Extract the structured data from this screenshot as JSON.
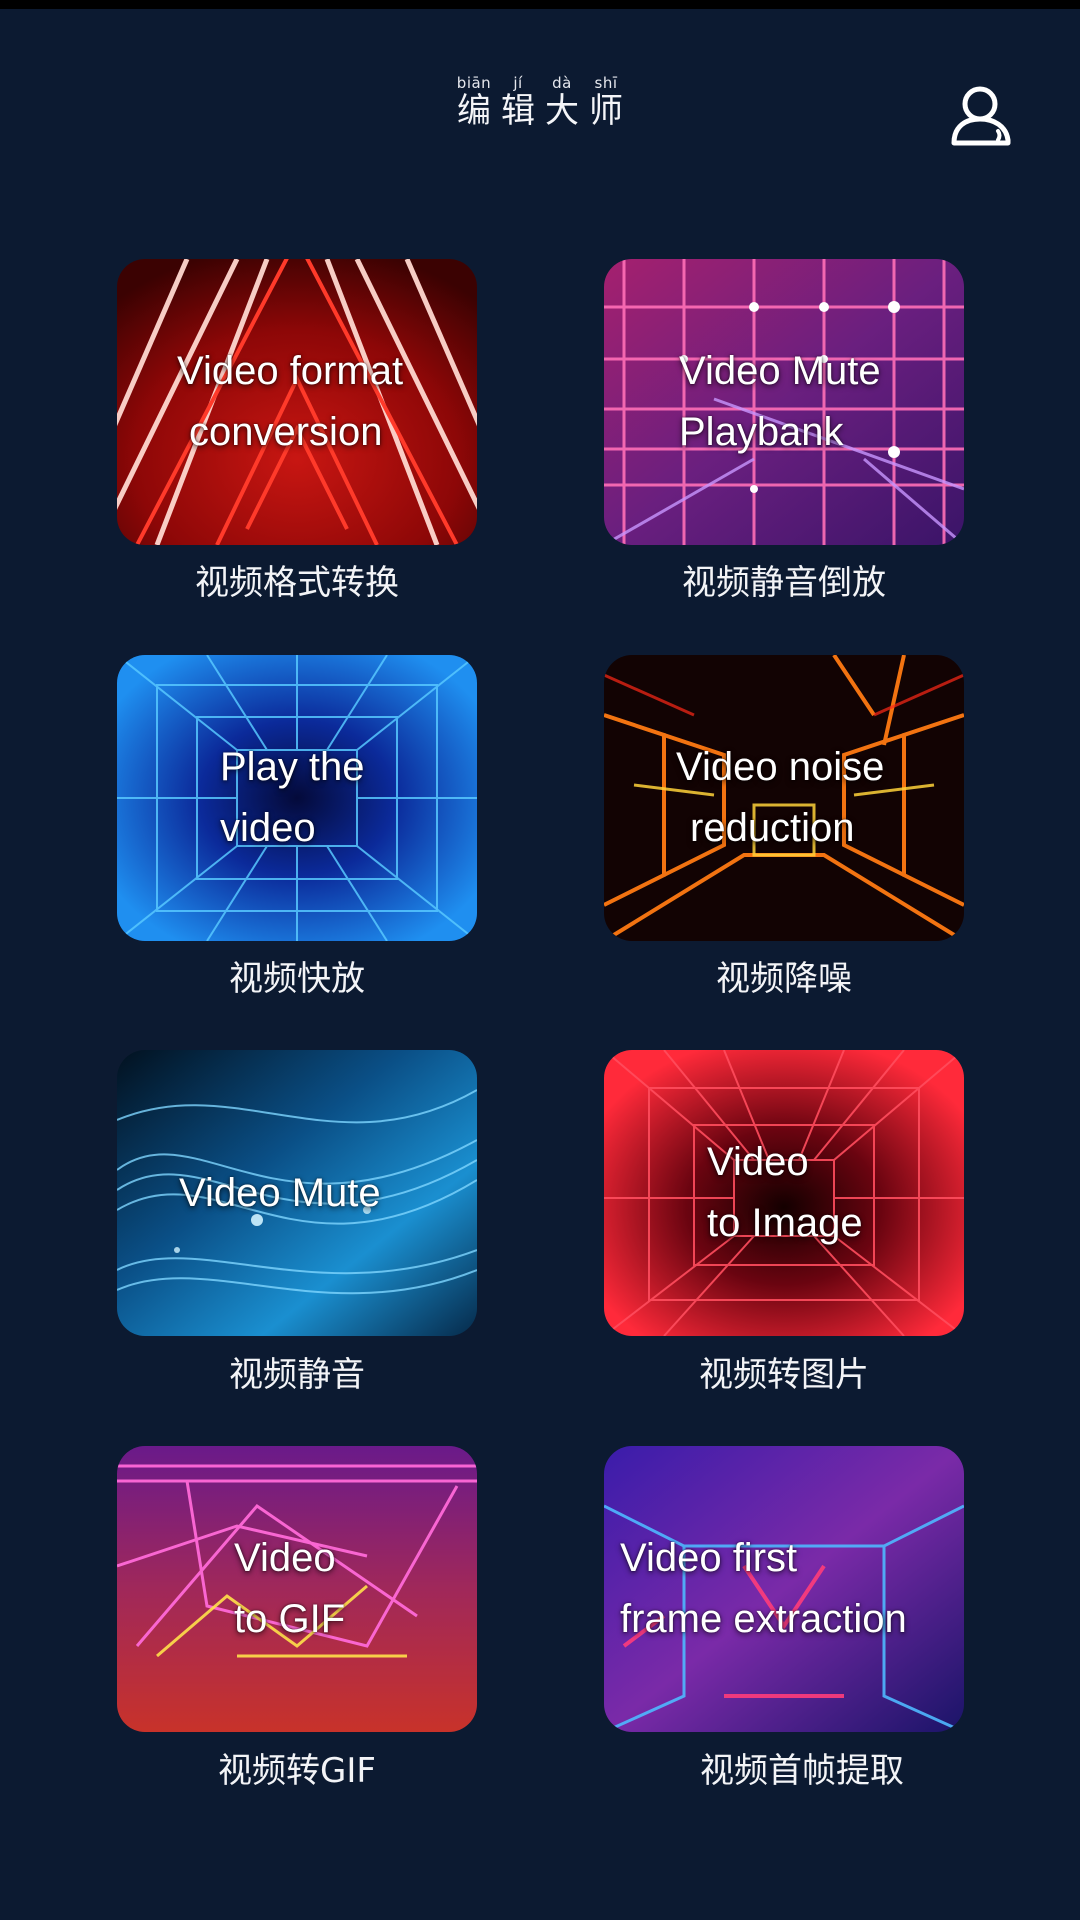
{
  "header": {
    "title_chars": [
      {
        "pinyin": "biān",
        "hanzi": "编"
      },
      {
        "pinyin": "jí",
        "hanzi": "辑"
      },
      {
        "pinyin": "dà",
        "hanzi": "大"
      },
      {
        "pinyin": "shī",
        "hanzi": "师"
      }
    ],
    "profile_icon": "user-icon"
  },
  "features": [
    {
      "banner_lines": [
        "Video format",
        "conversion"
      ],
      "caption": "视频格式转换"
    },
    {
      "banner_lines": [
        "Video Mute",
        "Playbank"
      ],
      "caption": "视频静音倒放"
    },
    {
      "banner_lines": [
        "Play the",
        "video"
      ],
      "caption": "视频快放"
    },
    {
      "banner_lines": [
        "Video noise",
        "reduction"
      ],
      "caption": "视频降噪"
    },
    {
      "banner_lines": [
        "Video Mute"
      ],
      "caption": "视频静音"
    },
    {
      "banner_lines": [
        "Video",
        "to Image"
      ],
      "caption": "视频转图片"
    },
    {
      "banner_lines": [
        "Video",
        "to GIF"
      ],
      "caption": "视频转GIF"
    },
    {
      "banner_lines": [
        "Video first",
        "frame extraction"
      ],
      "caption": "视频首帧提取"
    }
  ]
}
